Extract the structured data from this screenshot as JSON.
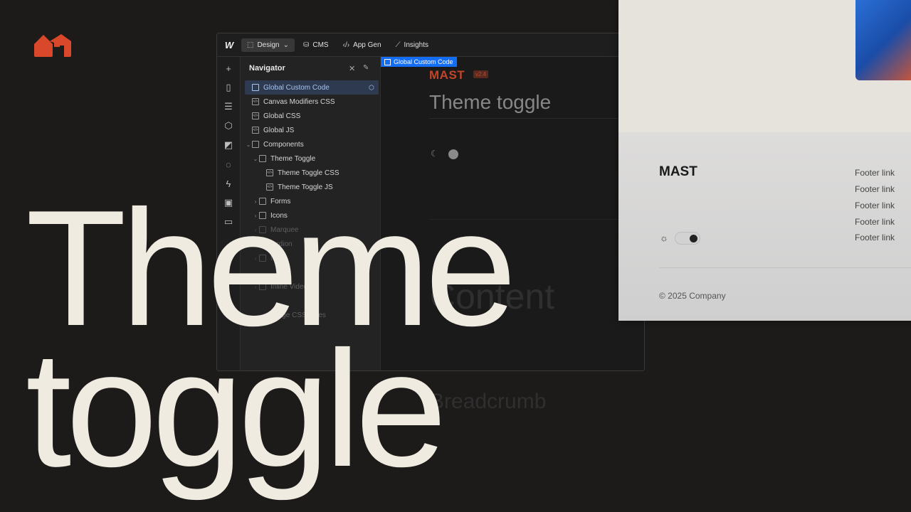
{
  "topbar": {
    "logo": "W",
    "tabs": [
      {
        "label": "Design",
        "icon": "cursor-icon"
      },
      {
        "label": "CMS",
        "icon": "database-icon"
      },
      {
        "label": "App Gen",
        "icon": "code-icon"
      },
      {
        "label": "Insights",
        "icon": "chart-icon"
      }
    ],
    "design_caret": "⌄"
  },
  "navigator": {
    "title": "Navigator",
    "items": [
      {
        "label": "Global Custom Code",
        "type": "box",
        "caret": ""
      },
      {
        "label": "Canvas Modifiers CSS",
        "type": "code",
        "caret": ""
      },
      {
        "label": "Global CSS",
        "type": "code",
        "caret": ""
      },
      {
        "label": "Global JS",
        "type": "code",
        "caret": ""
      },
      {
        "label": "Components",
        "type": "box",
        "caret": "⌄"
      },
      {
        "label": "Theme Toggle",
        "type": "box",
        "caret": "⌄"
      },
      {
        "label": "Theme Toggle CSS",
        "type": "code",
        "caret": ""
      },
      {
        "label": "Theme Toggle JS",
        "type": "code",
        "caret": ""
      },
      {
        "label": "Forms",
        "type": "box",
        "caret": "›"
      },
      {
        "label": "Icons",
        "type": "box",
        "caret": "›"
      },
      {
        "label": "Marquee",
        "type": "box",
        "caret": "›"
      },
      {
        "label": "...rdion",
        "type": "box",
        "caret": "›"
      },
      {
        "label": "M...",
        "type": "box",
        "caret": "›"
      },
      {
        "label": "Inline Video",
        "type": "box",
        "caret": "›"
      },
      {
        "label": "Page CSS ...des",
        "type": "box",
        "caret": ""
      }
    ]
  },
  "canvas": {
    "selected_tag": "Global Custom Code",
    "mast": "MAST",
    "version": "v2.4",
    "title": "Theme toggle",
    "content_text": "Content",
    "breadcrumb_text": "Breadcrumb"
  },
  "preview": {
    "mast": "MAST",
    "footer_links": [
      "Footer link",
      "Footer link",
      "Footer link",
      "Footer link",
      "Footer link"
    ],
    "copyright": "© 2025 Company"
  },
  "headline": {
    "line1": "Theme",
    "line2": "toggle"
  },
  "colors": {
    "accent_orange": "#d9482b",
    "webflow_blue": "#146ef5",
    "headline_cream": "#efebe1",
    "background": "#1d1b1a"
  }
}
